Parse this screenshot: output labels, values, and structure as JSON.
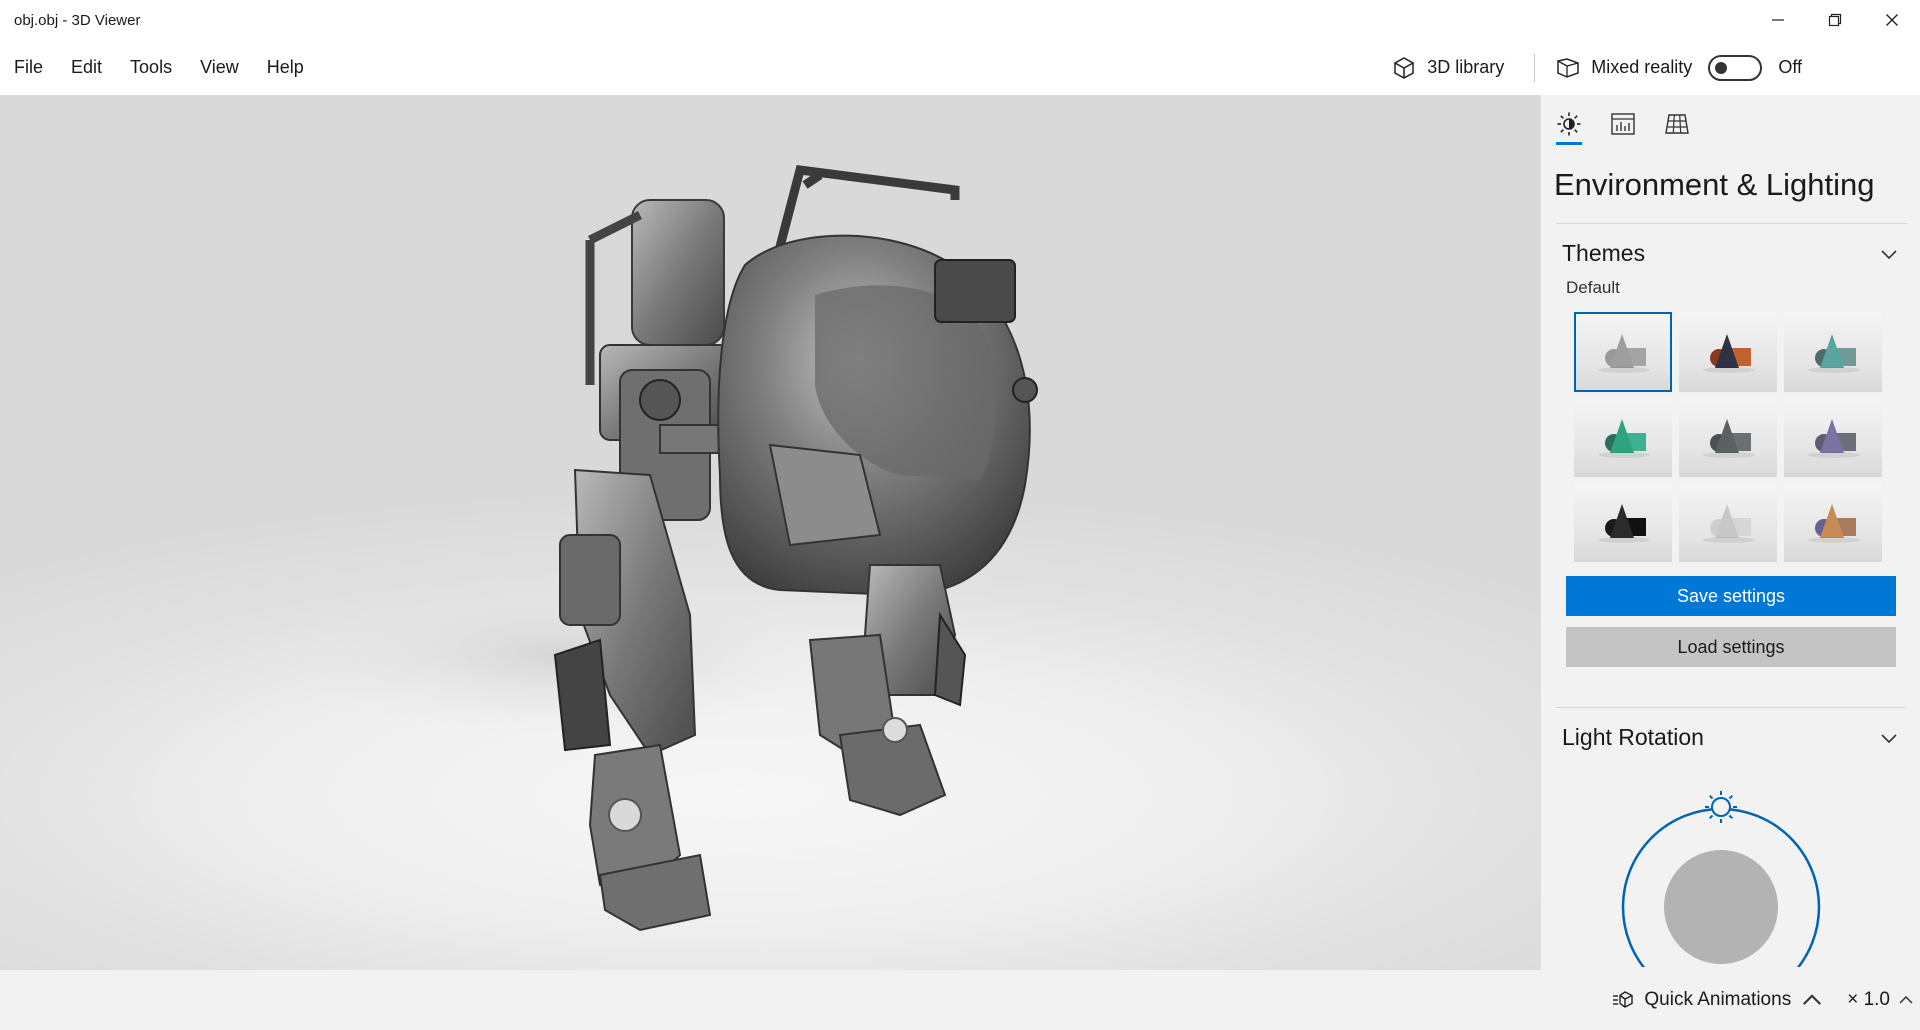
{
  "window": {
    "title": "obj.obj - 3D Viewer",
    "controls": {
      "minimize_icon": "minimize-icon",
      "restore_icon": "restore-icon",
      "close_icon": "close-icon"
    }
  },
  "menu": {
    "items": [
      {
        "label": "File"
      },
      {
        "label": "Edit"
      },
      {
        "label": "Tools"
      },
      {
        "label": "View"
      },
      {
        "label": "Help"
      }
    ],
    "library_label": "3D library",
    "mixed_reality_label": "Mixed reality",
    "mixed_reality_state": "Off"
  },
  "panel": {
    "tabs": [
      {
        "icon": "sun-lighting-icon",
        "active": true
      },
      {
        "icon": "stats-chart-icon",
        "active": false
      },
      {
        "icon": "mesh-grid-icon",
        "active": false
      }
    ],
    "title": "Environment & Lighting",
    "themes": {
      "heading": "Themes",
      "selected_label": "Default",
      "swatches": [
        {
          "cone": "#9e9e9e",
          "sphere": "#9a9a9a",
          "box": "#a4a4a4",
          "selected": true
        },
        {
          "cone": "#2f3347",
          "sphere": "#8a3b1e",
          "box": "#c0612f",
          "selected": false
        },
        {
          "cone": "#5aa5a0",
          "sphere": "#4d6b6a",
          "box": "#6f9a96",
          "selected": false
        },
        {
          "cone": "#2ea37f",
          "sphere": "#2a6f5d",
          "box": "#3fb193",
          "selected": false
        },
        {
          "cone": "#5b6062",
          "sphere": "#4b5052",
          "box": "#6a7072",
          "selected": false
        },
        {
          "cone": "#7b74a3",
          "sphere": "#5a5d6e",
          "box": "#6d6f78",
          "selected": false
        },
        {
          "cone": "#2b2b2b",
          "sphere": "#1a1a1a",
          "box": "#111111",
          "selected": false
        },
        {
          "cone": "#c8c8c8",
          "sphere": "#cfcfcf",
          "box": "#d6d6d6",
          "selected": false
        },
        {
          "cone": "#c98b55",
          "sphere": "#6a5f8f",
          "box": "#a97b5c",
          "selected": false
        }
      ],
      "save_label": "Save settings",
      "load_label": "Load settings"
    },
    "light_rotation": {
      "heading": "Light Rotation",
      "accent": "#0063b1",
      "disc_color": "#b3b3b3"
    }
  },
  "bottom": {
    "quick_animations_label": "Quick Animations",
    "speed_label": "× 1.0"
  },
  "colors": {
    "accent": "#0078d7",
    "model_metal": "#8a8a8a"
  }
}
